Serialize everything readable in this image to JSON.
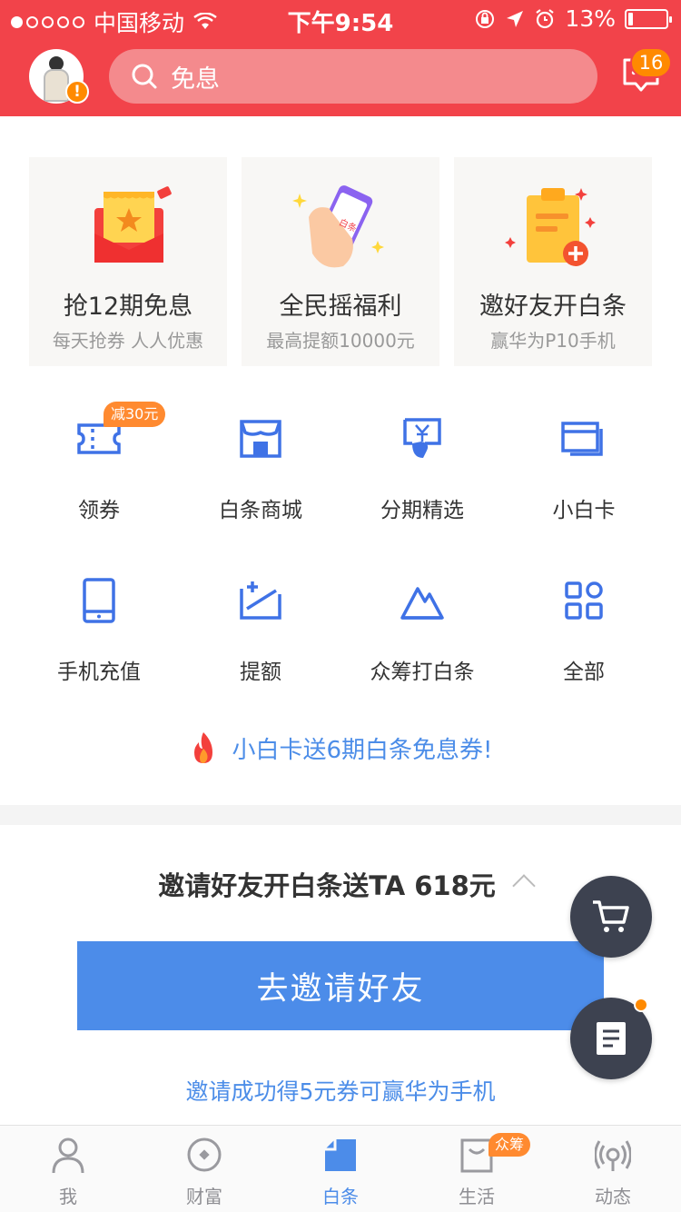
{
  "status_bar": {
    "carrier": "中国移动",
    "time": "下午9:54",
    "battery": "13%",
    "battery_level": 0.13
  },
  "header": {
    "search_placeholder": "免息",
    "message_count": "16",
    "avatar_badge": "!"
  },
  "promos": [
    {
      "title": "抢12期免息",
      "subtitle": "每天抢券 人人优惠",
      "icon": "red-envelope-icon"
    },
    {
      "title": "全民摇福利",
      "subtitle": "最高提额10000元",
      "icon": "shake-phone-icon",
      "phone_text": "白条"
    },
    {
      "title": "邀好友开白条",
      "subtitle": "赢华为P10手机",
      "icon": "clipboard-plus-icon"
    }
  ],
  "grid": [
    {
      "label": "领券",
      "icon": "coupon-icon",
      "tag": "减30元"
    },
    {
      "label": "白条商城",
      "icon": "store-icon"
    },
    {
      "label": "分期精选",
      "icon": "installment-icon"
    },
    {
      "label": "小白卡",
      "icon": "card-icon"
    },
    {
      "label": "手机充值",
      "icon": "phone-icon"
    },
    {
      "label": "提额",
      "icon": "raise-limit-icon"
    },
    {
      "label": "众筹打白条",
      "icon": "mountain-icon"
    },
    {
      "label": "全部",
      "icon": "grid-all-icon"
    }
  ],
  "banner_text": "小白卡送6期白条免息券!",
  "invite": {
    "title": "邀请好友开白条送TA 618元",
    "button": "去邀请好友",
    "note": "邀请成功得5元券可赢华为手机"
  },
  "tabs": [
    {
      "label": "我",
      "icon": "person-icon"
    },
    {
      "label": "财富",
      "icon": "wealth-icon"
    },
    {
      "label": "白条",
      "icon": "baitiao-icon",
      "active": true
    },
    {
      "label": "生活",
      "icon": "bag-icon",
      "badge": "众筹"
    },
    {
      "label": "动态",
      "icon": "broadcast-icon"
    }
  ],
  "colors": {
    "brand_red": "#f2434a",
    "accent_blue": "#4c8ce9",
    "badge_orange": "#ff8a00"
  }
}
